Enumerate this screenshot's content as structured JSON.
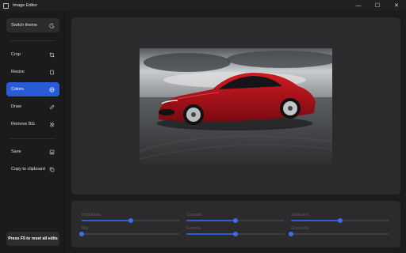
{
  "window": {
    "title": "Image Editor"
  },
  "sidebar": {
    "theme_label": "Switch theme",
    "items": [
      {
        "label": "Crop"
      },
      {
        "label": "Resize"
      },
      {
        "label": "Colors"
      },
      {
        "label": "Draw"
      },
      {
        "label": "Remove BG"
      }
    ],
    "save_label": "Save",
    "copy_label": "Copy to clipboard",
    "reset_label": "Press F5 to reset all edits"
  },
  "adjustments": [
    {
      "label": "Brightness",
      "value": 0.5
    },
    {
      "label": "Contrast",
      "value": 0.5
    },
    {
      "label": "Saturation",
      "value": 0.5
    },
    {
      "label": "Blur",
      "value": 0.0
    },
    {
      "label": "Gamma",
      "value": 0.5
    },
    {
      "label": "Grayscale",
      "value": 0.0
    }
  ],
  "colors": {
    "accent": "#2a5bd7",
    "background": "#1c1c1c",
    "panel": "#2b2b2d"
  }
}
